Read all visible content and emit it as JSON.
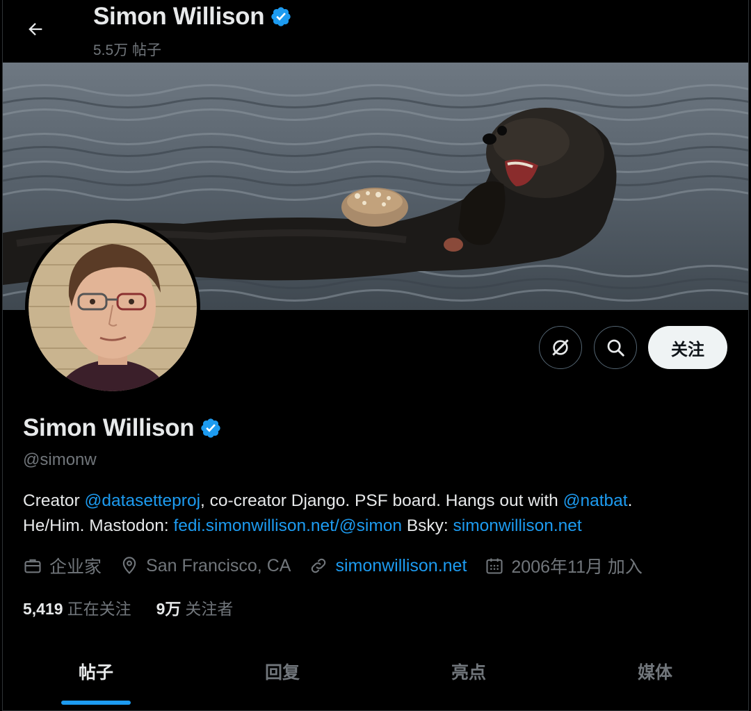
{
  "header": {
    "name": "Simon Willison",
    "post_count": "5.5万 帖子"
  },
  "actions": {
    "follow_label": "关注"
  },
  "profile": {
    "name": "Simon Willison",
    "handle": "@simonw",
    "bio": {
      "line1_a": "Creator ",
      "line1_link1": "@datasetteproj",
      "line1_b": ", co-creator Django. PSF board. Hangs out with ",
      "line1_link2": "@natbat",
      "line1_c": ".",
      "line2_a": "He/Him. Mastodon: ",
      "line2_link1": "fedi.simonwillison.net/@simon",
      "line2_b": " Bsky: ",
      "line2_link2": "simonwillison.net"
    },
    "meta": {
      "occupation": "企业家",
      "location": "San Francisco, CA",
      "website": "simonwillison.net",
      "joined": "2006年11月 加入"
    },
    "stats": {
      "following_count": "5,419",
      "following_label": "正在关注",
      "followers_count": "9万",
      "followers_label": "关注者"
    }
  },
  "tabs": [
    {
      "label": "帖子",
      "active": true
    },
    {
      "label": "回复",
      "active": false
    },
    {
      "label": "亮点",
      "active": false
    },
    {
      "label": "媒体",
      "active": false
    }
  ],
  "colors": {
    "accent": "#1d9bf0",
    "muted": "#71767b",
    "text": "#e7e9ea",
    "background": "#000000"
  }
}
